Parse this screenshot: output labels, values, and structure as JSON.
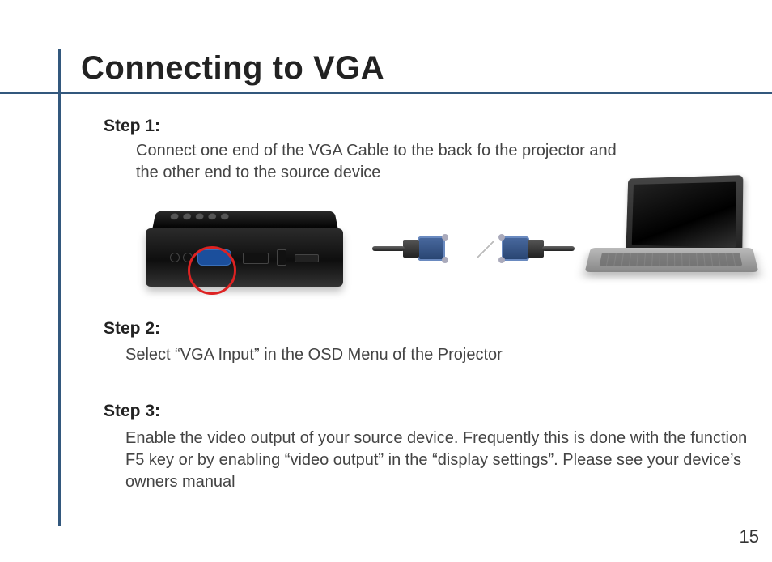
{
  "title": "Connecting to VGA",
  "steps": {
    "s1": {
      "heading": "Step 1:",
      "body": "Connect one end of the VGA Cable to the back fo the projector and the other end to the source device"
    },
    "s2": {
      "heading": "Step 2:",
      "body": "Select “VGA Input” in the OSD Menu of the Projector"
    },
    "s3": {
      "heading": "Step 3:",
      "body": "Enable the video output of your source device.  Frequently this is done with the function F5 key or by enabling “video output” in the “display settings”.  Please see your device’s owners manual"
    }
  },
  "page_number": "15"
}
